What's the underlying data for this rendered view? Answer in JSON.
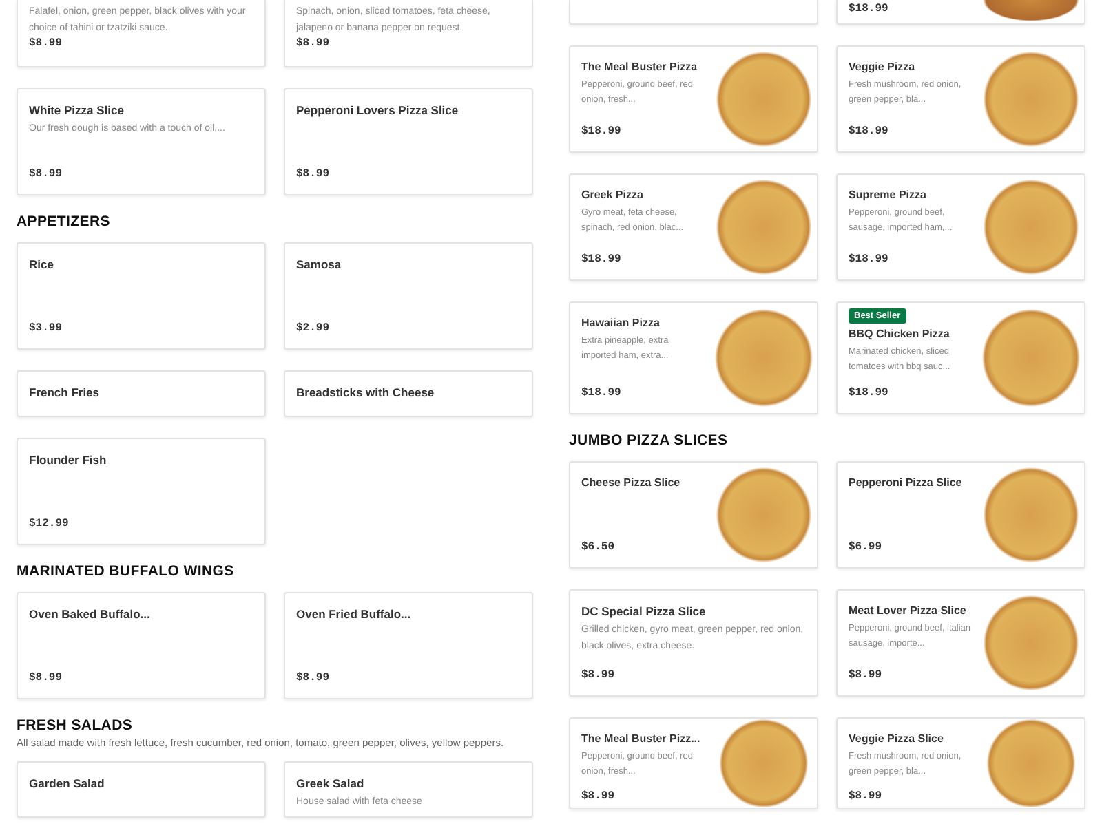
{
  "columns": [
    {
      "sections": [
        {
          "rows": [
            [
              {
                "kind": "cut",
                "description": "Falafel, onion, green pepper, black olives with your choice of tahini or tzatziki sauce.",
                "price": "$8.99",
                "photo": false
              },
              {
                "kind": "cut",
                "description": "Spinach, onion, sliced tomatoes, feta cheese, jalapeno or banana pepper on request.",
                "price": "$8.99",
                "photo": false
              }
            ],
            [
              {
                "kind": "full",
                "name": "White Pizza Slice",
                "description": "Our fresh dough is based with a touch of oil,...",
                "price": "$8.99",
                "photo": false
              },
              {
                "kind": "full",
                "name": "Pepperoni Lovers Pizza Slice",
                "price": "$8.99",
                "photo": false
              }
            ]
          ]
        },
        {
          "title": "APPETIZERS",
          "rows": [
            [
              {
                "kind": "full",
                "name": "Rice",
                "price": "$3.99",
                "photo": false
              },
              {
                "kind": "full",
                "name": "Samosa",
                "price": "$2.99",
                "photo": false
              }
            ],
            [
              {
                "kind": "short",
                "name": "French Fries",
                "photo": false
              },
              {
                "kind": "short",
                "name": "Breadsticks with Cheese",
                "photo": false
              }
            ],
            [
              {
                "kind": "full",
                "name": "Flounder Fish",
                "price": "$12.99",
                "photo": false
              }
            ]
          ]
        },
        {
          "title": "MARINATED BUFFALO WINGS",
          "rows": [
            [
              {
                "kind": "full",
                "name": "Oven Baked Buffalo...",
                "price": "$8.99",
                "photo": false
              },
              {
                "kind": "full",
                "name": "Oven Fried Buffalo...",
                "price": "$8.99",
                "photo": false
              }
            ]
          ]
        },
        {
          "title": "FRESH SALADS",
          "description": "All salad made with fresh lettuce, fresh cucumber, red onion, tomato, green pepper, olives, yellow peppers.",
          "rows": [
            [
              {
                "kind": "full",
                "name": "Garden Salad",
                "photo": false
              },
              {
                "kind": "full",
                "name": "Greek Salad",
                "description": "House salad with feta cheese",
                "photo": false
              }
            ]
          ]
        }
      ]
    },
    {
      "sections": [
        {
          "rows": [
            [
              {
                "kind": "cut",
                "photo": false
              },
              {
                "kind": "cut",
                "price": "$18.99",
                "photo": true
              }
            ],
            [
              {
                "kind": "full",
                "name": "The Meal Buster Pizza",
                "description": "Pepperoni, ground beef, red onion, fresh...",
                "price": "$18.99",
                "photo": true
              },
              {
                "kind": "full",
                "name": "Veggie Pizza",
                "description": "Fresh mushroom, red onion, green pepper, bla...",
                "price": "$18.99",
                "photo": true
              }
            ],
            [
              {
                "kind": "full",
                "name": "Greek Pizza",
                "description": "Gyro meat, feta cheese, spinach, red onion, blac...",
                "price": "$18.99",
                "photo": true
              },
              {
                "kind": "full",
                "name": "Supreme Pizza",
                "description": "Pepperoni, ground beef, sausage, imported ham,...",
                "price": "$18.99",
                "photo": true
              }
            ],
            [
              {
                "kind": "full",
                "name": "Hawaiian Pizza",
                "description": "Extra pineapple, extra imported ham, extra...",
                "price": "$18.99",
                "photo": true
              },
              {
                "kind": "full",
                "badge": "Best Seller",
                "name": "BBQ Chicken Pizza",
                "description": "Marinated chicken, sliced tomatoes with bbq sauc...",
                "price": "$18.99",
                "photo": true
              }
            ]
          ]
        },
        {
          "title": "JUMBO PIZZA SLICES",
          "rows": [
            [
              {
                "kind": "full",
                "name": "Cheese Pizza Slice",
                "price": "$6.50",
                "photo": true
              },
              {
                "kind": "full",
                "name": "Pepperoni Pizza Slice",
                "price": "$6.99",
                "photo": true
              }
            ],
            [
              {
                "kind": "full",
                "name": "DC Special Pizza Slice",
                "description": "Grilled chicken, gyro meat, green pepper, red onion, black olives, extra cheese.",
                "price": "$8.99",
                "photo": false
              },
              {
                "kind": "full",
                "name": "Meat Lover Pizza Slice",
                "description": "Pepperoni, ground beef, italian sausage, importe...",
                "price": "$8.99",
                "photo": true
              }
            ],
            [
              {
                "kind": "full",
                "name": "The Meal Buster Pizz...",
                "description": "Pepperoni, ground beef, red onion, fresh...",
                "price": "$8.99",
                "photo": true
              },
              {
                "kind": "full",
                "name": "Veggie Pizza Slice",
                "description": "Fresh mushroom, red onion, green pepper, bla...",
                "price": "$8.99",
                "photo": true
              }
            ]
          ]
        }
      ]
    }
  ]
}
